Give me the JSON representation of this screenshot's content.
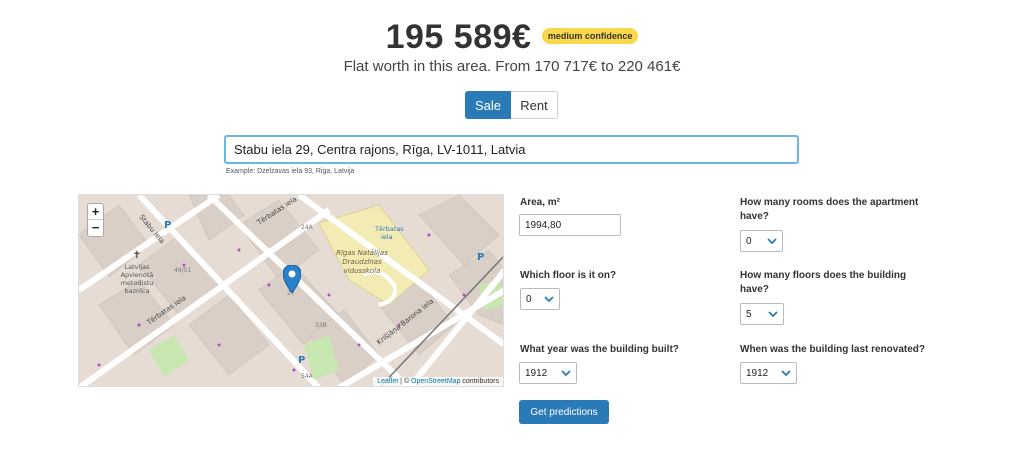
{
  "header": {
    "price": "195 589€",
    "confidence_badge": "medium confidence",
    "subtitle": "Flat worth in this area. From 170 717€ to 220 461€"
  },
  "mode_toggle": {
    "sale_label": "Sale",
    "rent_label": "Rent",
    "selected": "Sale"
  },
  "address": {
    "value": "Stabu iela 29, Centra rajons, Rīga, LV-1011, Latvia",
    "example": "Example: Dzelzavas iela 93, Riga, Latvija"
  },
  "map": {
    "zoom_in": "+",
    "zoom_out": "−",
    "attribution_leaflet": "Leaflet",
    "attribution_sep": " | © ",
    "attribution_osm": "OpenStreetMap",
    "attribution_suffix": " contributors",
    "labels": {
      "stabu": "Stabu iela",
      "terbatas1": "Tērbatas iela",
      "terbatas2": "Tērbatas iela",
      "terbatas_stop": "Tērbatas",
      "terbatas_stop2": "iela",
      "school1": "Rīgas Natālijas",
      "school2": "Draudzīnas",
      "school3": "vidusskola",
      "church1": "Latvijas",
      "church2": "Apvienotā",
      "church3": "metodistu",
      "church4": "baznīca",
      "barona": "Krišjāņa Barona iela",
      "num_24a": "24A",
      "num_49_51": "49/51",
      "num_27": "27",
      "num_33b": "33B",
      "num_54a": "54A",
      "parking": "P"
    },
    "colors": {
      "background": "#e6dcd4",
      "building": "#d9cfc7",
      "road": "#ffffff",
      "school_area": "#f2ecb4",
      "park": "#c8e6b0",
      "marker": "#2a81cb"
    }
  },
  "form": {
    "area_label": "Area, m²",
    "area_value": "1994,80",
    "rooms_label_1": "How many rooms does the apartment",
    "rooms_label_2": "have?",
    "rooms_value": "0",
    "floor_label": "Which floor is it on?",
    "floor_value": "0",
    "floors_label_1": "How many floors does the building",
    "floors_label_2": "have?",
    "floors_value": "5",
    "built_label": "What year was the building built?",
    "built_value": "1912",
    "renovated_label": "When was the building last renovated?",
    "renovated_value": "1912",
    "submit_label": "Get predictions"
  },
  "icons": {
    "chevron": "chevron-down-icon",
    "marker": "map-marker-icon"
  }
}
